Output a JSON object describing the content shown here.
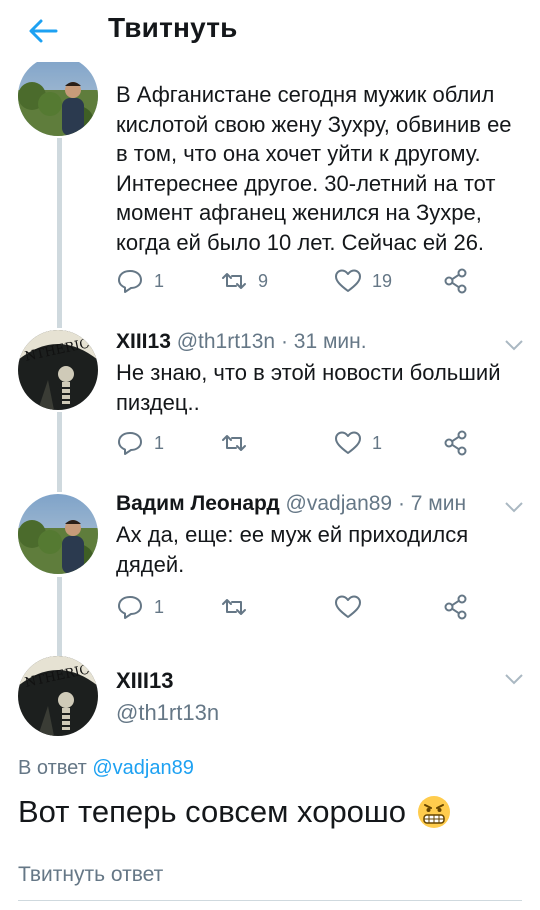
{
  "header": {
    "title": "Твитнуть"
  },
  "colors": {
    "accent": "#1da1f2",
    "text": "#14171a",
    "secondary": "#657786",
    "divider": "#cfd9de"
  },
  "tweets": [
    {
      "text_lines": [
        "В Афганистане сегодня мужик облил",
        "кислотой свою жену Зухру, обвинив ее",
        "в том, что она хочет уйти к другому.",
        "Интереснее другое. 30-летний на тот",
        "момент афганец женился на Зухре,",
        "когда ей было 10 лет. Сейчас ей 26."
      ],
      "replies": "1",
      "retweets": "9",
      "likes": "19"
    },
    {
      "name": "XIII13",
      "handle": "@th1rt13n",
      "time": "· 31 мин.",
      "text_lines": [
        "Не знаю, что в этой новости больший",
        "пиздец.."
      ],
      "replies": "1",
      "retweets": "",
      "likes": "1"
    },
    {
      "name": "Вадим Леонард",
      "handle": "@vadjan89",
      "time": "· 7 мин",
      "text_lines": [
        "Ах да, еще: ее муж ей приходился",
        "дядей."
      ],
      "replies": "1",
      "retweets": "",
      "likes": ""
    }
  ],
  "main": {
    "name": "XIII13",
    "handle": "@th1rt13n",
    "reply_prefix": "В ответ",
    "reply_handle": "@vadjan89",
    "text": "Вот теперь совсем хорошо",
    "emoji": "grimacing-face-emoji"
  },
  "compose": {
    "placeholder": "Твитнуть ответ"
  }
}
